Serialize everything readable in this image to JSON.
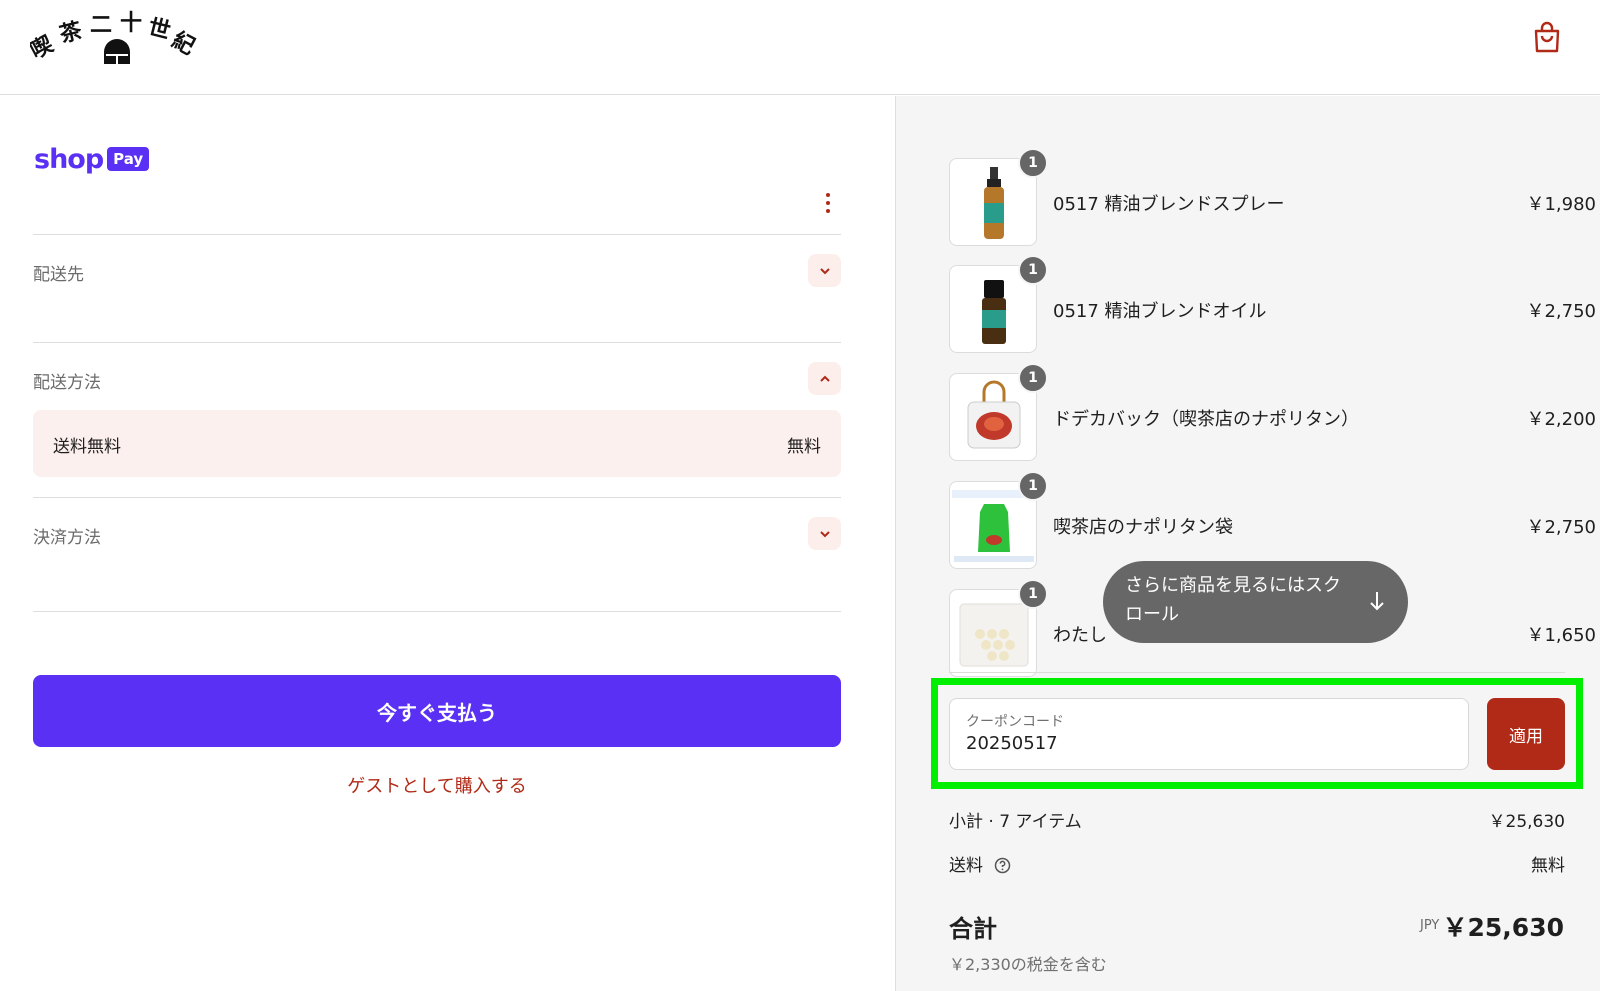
{
  "header": {
    "logo_text": "喫茶二十世紀",
    "cart_icon": "shopping-bag-icon",
    "accent": "#b02a17"
  },
  "left": {
    "shoppay": {
      "shop": "shop",
      "pay": "Pay",
      "brand_color": "#5a31f4"
    },
    "more_icon": "vertical-ellipsis-icon",
    "sections": {
      "shipping_address": {
        "label": "配送先",
        "icon": "chevron-down-icon"
      },
      "shipping_method": {
        "label": "配送方法",
        "icon": "chevron-up-icon",
        "option_name": "送料無料",
        "option_price": "無料"
      },
      "payment_method": {
        "label": "決済方法",
        "icon": "chevron-down-icon"
      }
    },
    "pay_now_label": "今すぐ支払う",
    "guest_link": "ゲストとして購入する"
  },
  "cart": {
    "items": [
      {
        "qty": "1",
        "name": "0517 精油ブレンドスプレー",
        "price": "￥1,980"
      },
      {
        "qty": "1",
        "name": "0517 精油ブレンドオイル",
        "price": "￥2,750"
      },
      {
        "qty": "1",
        "name": "ドデカバック（喫茶店のナポリタン）",
        "price": "￥2,200"
      },
      {
        "qty": "1",
        "name": "喫茶店のナポリタン袋",
        "price": "￥2,750"
      },
      {
        "qty": "1",
        "name": "わたし",
        "price": "￥1,650"
      }
    ],
    "scroll_tip": "さらに商品を見るにはスクロール",
    "coupon": {
      "placeholder": "クーポンコード",
      "value": "20250517",
      "apply_label": "適用"
    },
    "subtotal": {
      "label": "小計 · 7 アイテム",
      "value": "￥25,630"
    },
    "shipping": {
      "label": "送料",
      "value": "無料"
    },
    "total": {
      "label": "合計",
      "currency": "JPY",
      "value": "￥25,630"
    },
    "tax_note": "￥2,330の税金を含む"
  }
}
